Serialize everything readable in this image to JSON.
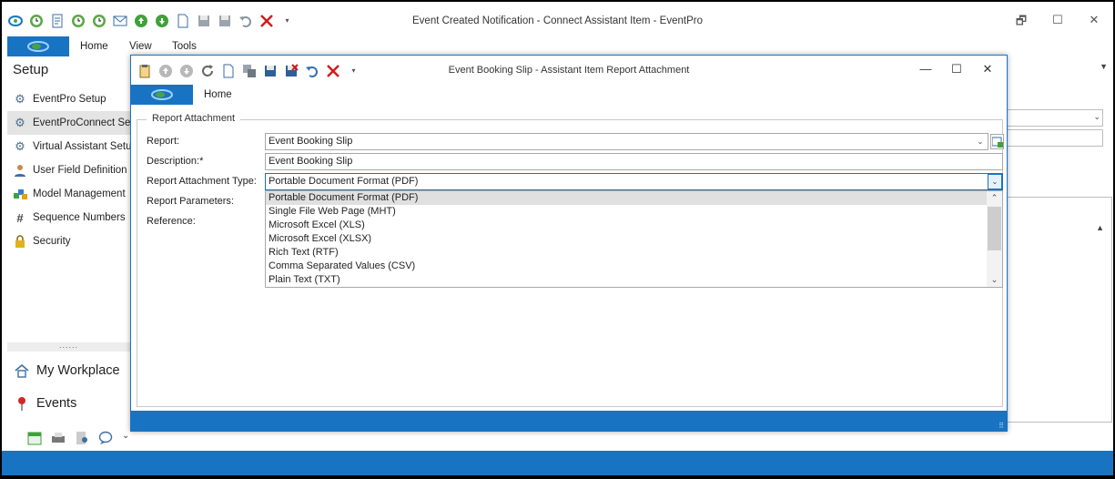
{
  "main_window": {
    "title": "Event Created Notification - Connect Assistant Item - EventPro",
    "tabs": [
      "Home",
      "View",
      "Tools"
    ],
    "qat_icons": [
      "refresh-icon",
      "clock-icon",
      "document-icon",
      "clock-icon",
      "clock-icon",
      "mail-icon",
      "up-circle-icon",
      "down-circle-icon",
      "new-page-icon",
      "save-icon",
      "save-close-icon",
      "undo-icon",
      "close-x-icon",
      "customize-arrow-icon"
    ],
    "controls": {
      "restore": "🗗",
      "maximize": "☐",
      "close": "✕"
    }
  },
  "sidebar": {
    "title": "Setup",
    "items": [
      {
        "label": "EventPro Setup",
        "icon": "gear-icon"
      },
      {
        "label": "EventProConnect Setup",
        "icon": "gear-icon"
      },
      {
        "label": "Virtual Assistant Setup",
        "icon": "gear-icon"
      },
      {
        "label": "User Field Definition",
        "icon": "user-icon"
      },
      {
        "label": "Model Management",
        "icon": "model-icon"
      },
      {
        "label": "Sequence Numbers",
        "icon": "hash-icon"
      },
      {
        "label": "Security",
        "icon": "lock-icon"
      }
    ],
    "splitter": "......",
    "nav": [
      {
        "label": "My Workplace",
        "icon": "home-icon"
      },
      {
        "label": "Events",
        "icon": "pin-icon"
      }
    ],
    "bottom_icons": [
      "calendar-icon",
      "printer-icon",
      "contacts-icon",
      "chat-icon",
      "expand-icon"
    ]
  },
  "dialog": {
    "title": "Event Booking Slip - Assistant Item Report Attachment",
    "tabs": [
      "Home"
    ],
    "controls": {
      "minimize": "—",
      "maximize": "☐",
      "close": "✕"
    },
    "group_title": "Report Attachment",
    "fields": {
      "report": {
        "label": "Report:",
        "value": "Event Booking Slip"
      },
      "description": {
        "label": "Description:*",
        "value": "Event Booking Slip"
      },
      "attachment_type": {
        "label": "Report Attachment Type:",
        "value": "Portable Document Format (PDF)"
      },
      "parameters": {
        "label": "Report Parameters:"
      },
      "reference": {
        "label": "Reference:"
      }
    },
    "options": [
      "Portable Document Format (PDF)",
      "Single File Web Page (MHT)",
      "Microsoft Excel (XLS)",
      "Microsoft Excel (XLSX)",
      "Rich Text (RTF)",
      "Comma Separated Values (CSV)",
      "Plain Text (TXT)"
    ],
    "selected_option": "Portable Document Format (PDF)"
  },
  "colors": {
    "accent": "#1874c3",
    "selected_row": "#e0e0e0"
  }
}
